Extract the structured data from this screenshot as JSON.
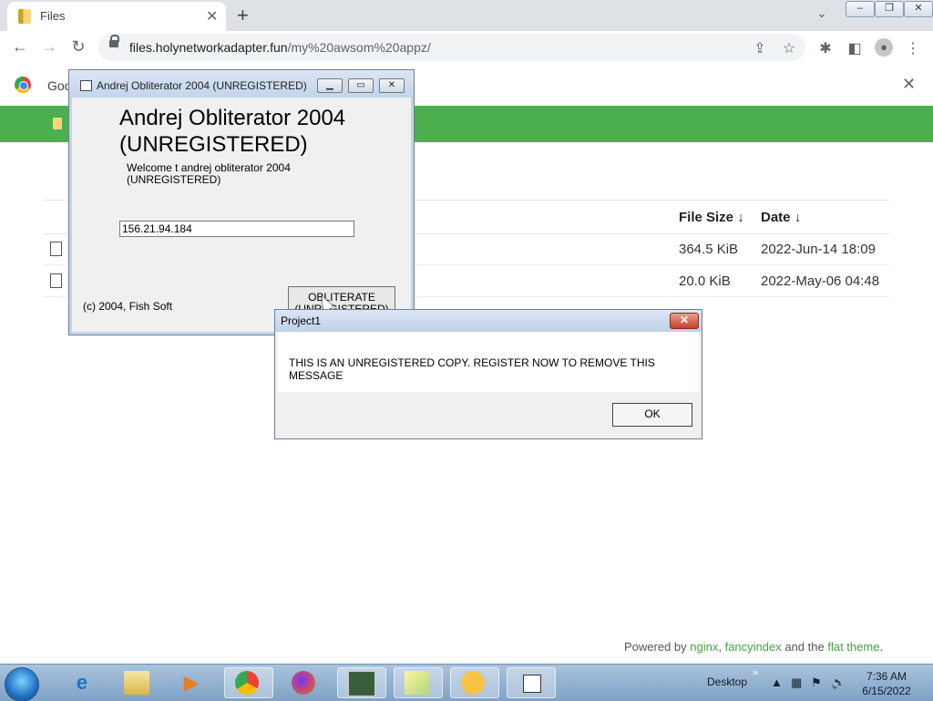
{
  "browser": {
    "tab_title": "Files",
    "new_tab_symbol": "+",
    "url_domain": "files.holynetworkadapter.fun",
    "url_path": "/my%20awsom%20appz/",
    "infobar_text": "Goo"
  },
  "file_listing": {
    "columns": {
      "size": "File Size",
      "size_sort": "↓",
      "date": "Date",
      "date_sort": "↓"
    },
    "rows": [
      {
        "size": "364.5 KiB",
        "date": "2022-Jun-14 18:09"
      },
      {
        "size": "20.0 KiB",
        "date": "2022-May-06 04:48"
      }
    ],
    "footer": {
      "prefix": "Powered by ",
      "nginx": "nginx",
      "sep1": ", ",
      "fancyindex": "fancyindex",
      "mid": " and the ",
      "theme": "flat theme",
      "end": "."
    }
  },
  "app_window": {
    "title": "Andrej Obliterator 2004 (UNREGISTERED)",
    "heading_line1": "Andrej Obliterator 2004",
    "heading_line2": "(UNREGISTERED)",
    "welcome_line1": "Welcome t andrej obliterator 2004",
    "welcome_line2": "(UNREGISTERED)",
    "ip_value": "156.21.94.184",
    "copyright": "(c) 2004, Fish Soft",
    "button_line1": "OBLITERATE",
    "button_line2": "(UNREGISTERED)"
  },
  "message_box": {
    "title": "Project1",
    "text": "THIS IS AN UNREGISTERED COPY. REGISTER NOW TO REMOVE THIS MESSAGE",
    "ok_label": "OK"
  },
  "taskbar": {
    "desktop_label": "Desktop",
    "time": "7:36 AM",
    "date": "6/15/2022"
  }
}
